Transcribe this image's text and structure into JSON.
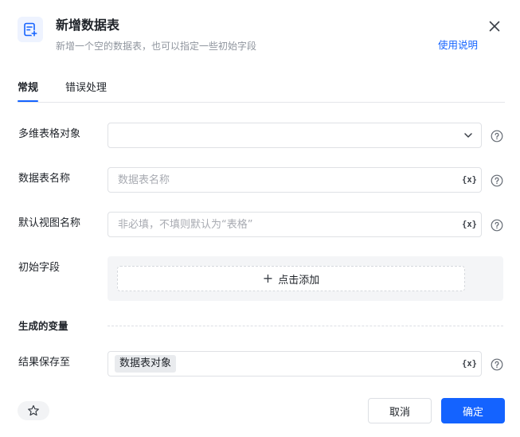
{
  "header": {
    "title": "新增数据表",
    "subtitle": "新增一个空的数据表，也可以指定一些初始字段",
    "help_link": "使用说明",
    "icon": "table-add-icon",
    "close_icon": "close-icon"
  },
  "tabs": [
    {
      "label": "常规",
      "active": true
    },
    {
      "label": "错误处理",
      "active": false
    }
  ],
  "form": {
    "table_object": {
      "label": "多维表格对象",
      "value": "",
      "placeholder": ""
    },
    "table_name": {
      "label": "数据表名称",
      "value": "",
      "placeholder": "数据表名称"
    },
    "view_name": {
      "label": "默认视图名称",
      "value": "",
      "placeholder": "非必填，不填则默认为“表格”"
    },
    "initial_fields": {
      "label": "初始字段",
      "add_label": "点击添加"
    },
    "variable_button": "{x}"
  },
  "output": {
    "section_title": "生成的变量",
    "save_to_label": "结果保存至",
    "save_to_value": "数据表对象"
  },
  "footer": {
    "favorite_icon": "star-icon",
    "cancel_label": "取消",
    "confirm_label": "确定"
  },
  "colors": {
    "accent": "#1463ff",
    "border": "#dfe1e5",
    "muted_text": "#8f959e"
  }
}
